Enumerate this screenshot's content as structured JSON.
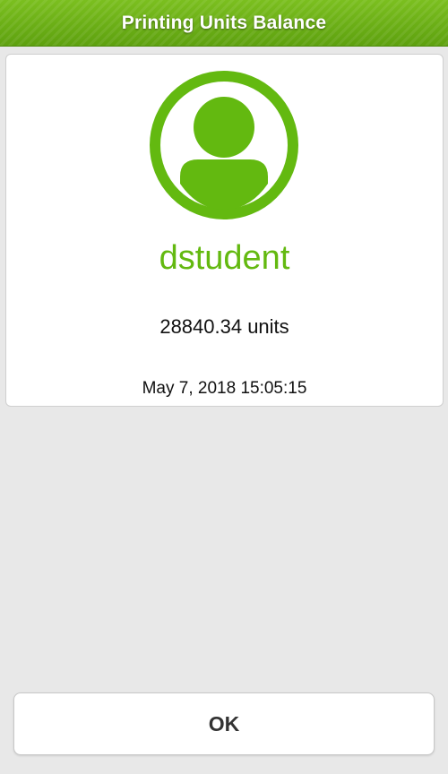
{
  "header": {
    "title": "Printing Units Balance"
  },
  "account": {
    "avatar_icon": "user-avatar-icon",
    "username": "dstudent",
    "balance": "28840.34 units",
    "timestamp": "May 7, 2018 15:05:15"
  },
  "actions": {
    "ok_label": "OK"
  },
  "colors": {
    "brand_green": "#63b910",
    "header_green": "#6aad14",
    "background": "#e8e8e8"
  }
}
